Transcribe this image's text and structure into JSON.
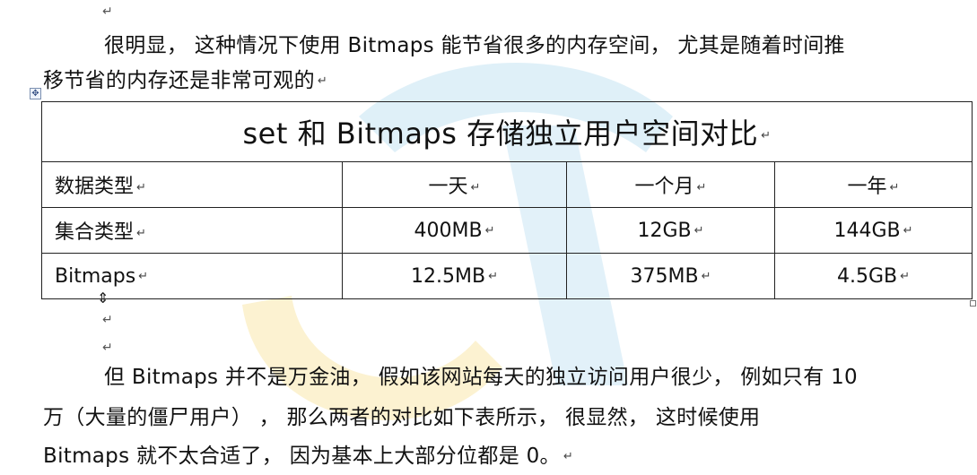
{
  "doc": {
    "para1_line1": "很明显， 这种情况下使用 Bitmaps 能节省很多的内存空间， 尤其是随着时间推",
    "para1_line2": "移节省的内存还是非常可观的",
    "para2_line1": "但 Bitmaps 并不是万金油， 假如该网站每天的独立访问用户很少， 例如只有 10",
    "para2_line2": "万（大量的僵尸用户）  ， 那么两者的对比如下表所示， 很显然， 这时候使用",
    "para2_line3": "Bitmaps 就不太合适了， 因为基本上大部分位都是 0。"
  },
  "table": {
    "title": "set 和 Bitmaps 存储独立用户空间对比",
    "header": [
      "数据类型",
      "一天",
      "一个月",
      "一年"
    ],
    "rows": [
      [
        "集合类型",
        "400MB",
        "12GB",
        "144GB"
      ],
      [
        "Bitmaps",
        "12.5MB",
        "375MB",
        "4.5GB"
      ]
    ]
  },
  "marks": {
    "return": "↵",
    "anchor": "✥",
    "resize": "⇕"
  },
  "colors": {
    "watermark_blue": "#dbeef7",
    "watermark_yellow": "#fbefc6",
    "border": "#222222"
  }
}
